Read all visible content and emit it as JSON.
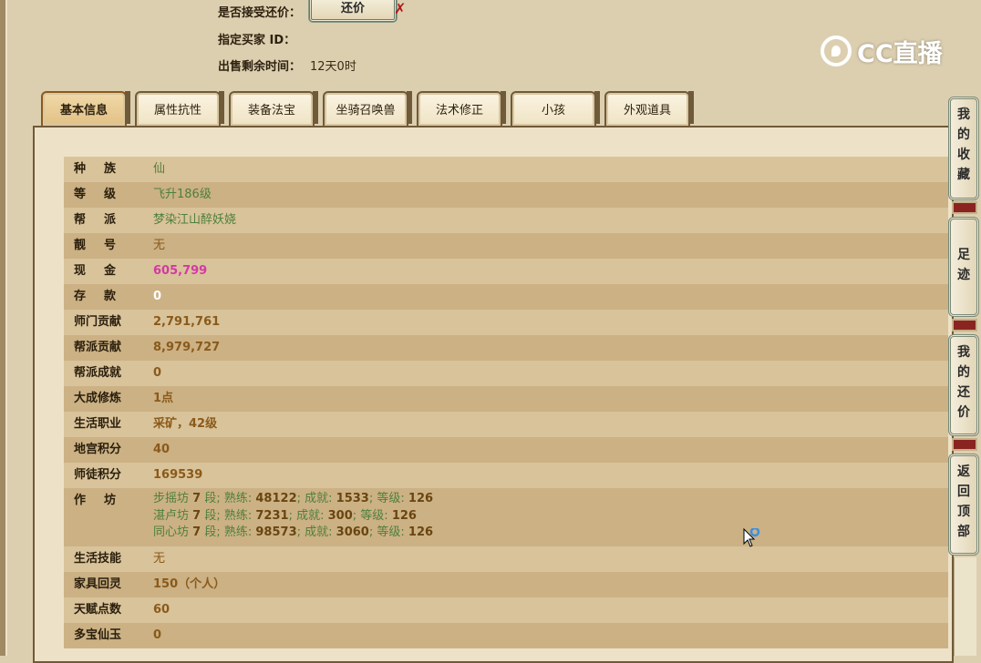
{
  "header": {
    "accept_counter_label": "是否接受还价：",
    "counter_button": "还价",
    "buyer_id_label": "指定买家 ID：",
    "remaining_label": "出售剩余时间：",
    "remaining_value": "12天0时"
  },
  "logo": {
    "text": "CC直播"
  },
  "tabs": [
    {
      "label": "基本信息",
      "active": true
    },
    {
      "label": "属性抗性"
    },
    {
      "label": "装备法宝"
    },
    {
      "label": "坐骑召唤兽"
    },
    {
      "label": "法术修正"
    },
    {
      "label": "小孩"
    },
    {
      "label": "外观道具"
    }
  ],
  "rows": {
    "race": {
      "label": "种族",
      "value": "仙"
    },
    "level": {
      "label": "等级",
      "value": "飞升186级"
    },
    "guild": {
      "label": "帮派",
      "value": "梦染江山醉妖娆"
    },
    "vanity_id": {
      "label": "靓号",
      "value": "无"
    },
    "cash": {
      "label": "现金",
      "value": "605,799"
    },
    "deposit": {
      "label": "存款",
      "value": "0"
    },
    "school_contrib": {
      "label": "师门贡献",
      "value": "2,791,761"
    },
    "guild_contrib": {
      "label": "帮派贡献",
      "value": "8,979,727"
    },
    "guild_achieve": {
      "label": "帮派成就",
      "value": "0"
    },
    "cultivation": {
      "label": "大成修炼",
      "value": "1点"
    },
    "life_job": {
      "label": "生活职业",
      "value": "采矿，42级"
    },
    "dungeon_score": {
      "label": "地宫积分",
      "value": "40"
    },
    "mentor_score": {
      "label": "师徒积分",
      "value": "169539"
    },
    "workshop": {
      "label": "作坊",
      "lines": [
        {
          "name": "步摇坊",
          "rank": "7",
          "seg": "段; 熟练:",
          "skill": "48122",
          "ach_label": "; 成就:",
          "ach": "1533",
          "lvl_label": "; 等级:",
          "lvl": "126"
        },
        {
          "name": "湛卢坊",
          "rank": "7",
          "seg": "段; 熟练:",
          "skill": "7231",
          "ach_label": "; 成就:",
          "ach": "300",
          "lvl_label": "; 等级:",
          "lvl": "126"
        },
        {
          "name": "同心坊",
          "rank": "7",
          "seg": "段; 熟练:",
          "skill": "98573",
          "ach_label": "; 成就:",
          "ach": "3060",
          "lvl_label": "; 等级:",
          "lvl": "126"
        }
      ]
    },
    "life_skill": {
      "label": "生活技能",
      "value": "无"
    },
    "furniture_spirit": {
      "label": "家具回灵",
      "value": "150（个人）"
    },
    "talent_points": {
      "label": "天赋点数",
      "value": "60"
    },
    "jade": {
      "label": "多宝仙玉",
      "value": "0"
    }
  },
  "side_bar": {
    "favorites": "我的收藏",
    "footprint": "足迹",
    "my_counter": "我的还价",
    "back_top": "返回顶部"
  },
  "colors": {
    "row_light": "#d9c39a",
    "row_dark": "#cbb184",
    "green_text": "#4f7f3c",
    "pink_text": "#d23aa4",
    "brown_text": "#8a5a1a"
  }
}
